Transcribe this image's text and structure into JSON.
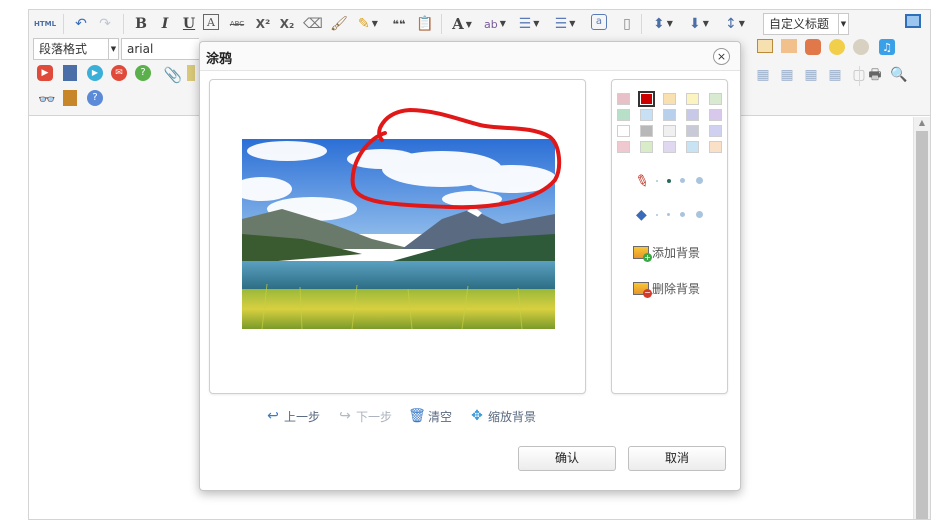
{
  "toolbar": {
    "html_label": "HTML",
    "bold_label": "B",
    "italic_label": "I",
    "underline_label": "U",
    "strikethrough_label": "ABC",
    "superscript_label": "X²",
    "subscript_label": "X₂",
    "font_color_label": "A",
    "quote_label": "❝❝",
    "paragraph_format": "段落格式",
    "font_family": "arial",
    "custom_heading": "自定义标题"
  },
  "dialog": {
    "title": "涂鸦",
    "close_label": "×",
    "colors": [
      "#e8c0c8",
      "#cc0000",
      "#f8e0b0",
      "#fbf3c0",
      "#d8ebd0",
      "#b8e0c8",
      "#c8e0f4",
      "#b8d0ec",
      "#c8c8e8",
      "#d8c8ec",
      "#ffffff",
      "#b8b8b8",
      "#f0f0f0",
      "#c8cad8",
      "#d0d0f0",
      "#f0c8d0",
      "#d8ecc8",
      "#e0d8f0",
      "#c8e4f4",
      "#fbe0c8"
    ],
    "brush_icon": "pencil-icon",
    "eraser_icon": "eraser-icon",
    "add_background_label": "添加背景",
    "remove_background_label": "删除背景",
    "undo_label": "上一步",
    "redo_label": "下一步",
    "clear_label": "清空",
    "scale_background_label": "缩放背景",
    "confirm_label": "确认",
    "cancel_label": "取消"
  }
}
